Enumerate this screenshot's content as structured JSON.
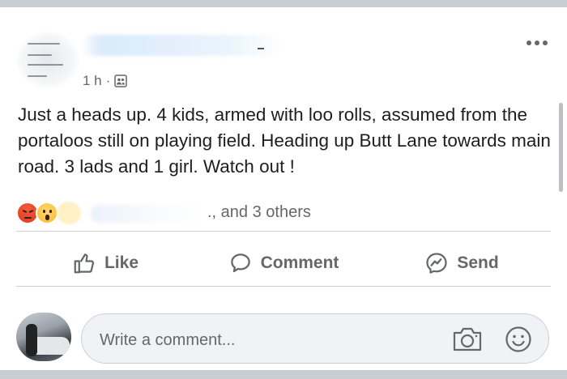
{
  "post": {
    "timestamp": "1 h",
    "separator": "·",
    "privacy_icon": "group-members-icon",
    "more_icon": "more-options-icon",
    "text": "Just a heads up. 4 kids, armed with loo rolls, assumed from the portaloos still on playing field. Heading up Butt Lane towards main road.  3 lads and 1 girl. Watch out !"
  },
  "reactions": {
    "types": [
      "angry",
      "wow",
      "haha"
    ],
    "summary": "., and 3 others"
  },
  "actions": [
    {
      "label": "Like",
      "icon": "thumbs-up-icon"
    },
    {
      "label": "Comment",
      "icon": "speech-bubble-icon"
    },
    {
      "label": "Send",
      "icon": "messenger-icon"
    }
  ],
  "composer": {
    "placeholder": "Write a comment...",
    "camera_icon": "camera-icon",
    "emoji_icon": "smiley-icon"
  },
  "colors": {
    "background": "#c9ccd1",
    "card": "#ffffff",
    "text": "#1c1e21",
    "secondary_text": "#65676b",
    "divider": "#ced0d4",
    "comment_box": "#f0f2f5"
  }
}
